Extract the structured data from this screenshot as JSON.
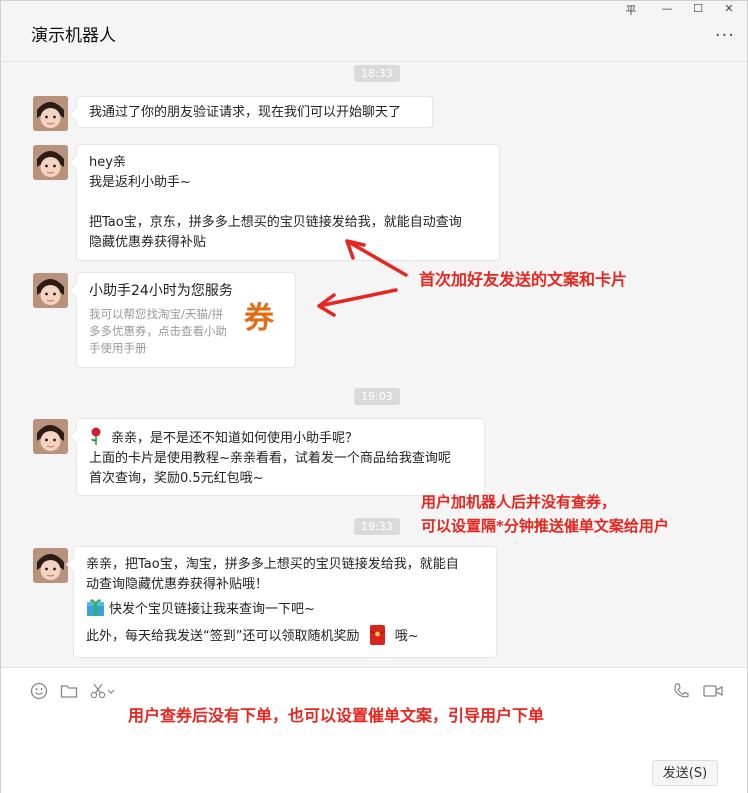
{
  "window": {
    "title": "演示机器人",
    "controls": {
      "pin": "平",
      "minimize": "—",
      "maximize": "☐",
      "close": "✕"
    },
    "more": "···"
  },
  "messages": {
    "time1": "18:33",
    "m1": "我通过了你的朋友验证请求，现在我们可以开始聊天了",
    "m2": [
      "hey亲",
      "我是返利小助手~",
      "",
      "把Tao宝，京东，拼多多上想买的宝贝链接发给我，就能自动查询",
      "隐藏优惠券获得补贴"
    ],
    "card": {
      "title": "小助手24小时为您服务",
      "desc": "我可以帮您找淘宝/天猫/拼多多优惠券，点击查看小助手使用手册",
      "icon_text": "券"
    },
    "time2": "19:03",
    "m3_first": "亲亲，是不是还不知道如何使用小助手呢？",
    "m3": [
      "上面的卡片是使用教程~亲亲看看，试着发一个商品给我查询呢",
      "首次查询，奖励0.5元红包哦~"
    ],
    "time3": "19:33",
    "m4": [
      "亲亲，把Tao宝，淘宝，拼多多上想买的宝贝链接发给我，就能自",
      "动查询隐藏优惠券获得补贴哦！"
    ],
    "m4_gift": "快发个宝贝链接让我来查询一下吧~",
    "m4_last_a": "此外，每天给我发送“签到”还可以领取随机奖励",
    "m4_last_b": "哦~"
  },
  "annotations": {
    "a1": "首次加好友发送的文案和卡片",
    "a2_line1": "用户加机器人后并没有查券，",
    "a2_line2": "可以设置隔*分钟推送催单文案给用户",
    "a3": "用户查券后没有下单，也可以设置催单文案，引导用户下单"
  },
  "input": {
    "send_label": "发送(S)"
  },
  "colors": {
    "annotation": "#e8251e",
    "coupon": "#e36b13",
    "background": "#f5f5f5"
  }
}
